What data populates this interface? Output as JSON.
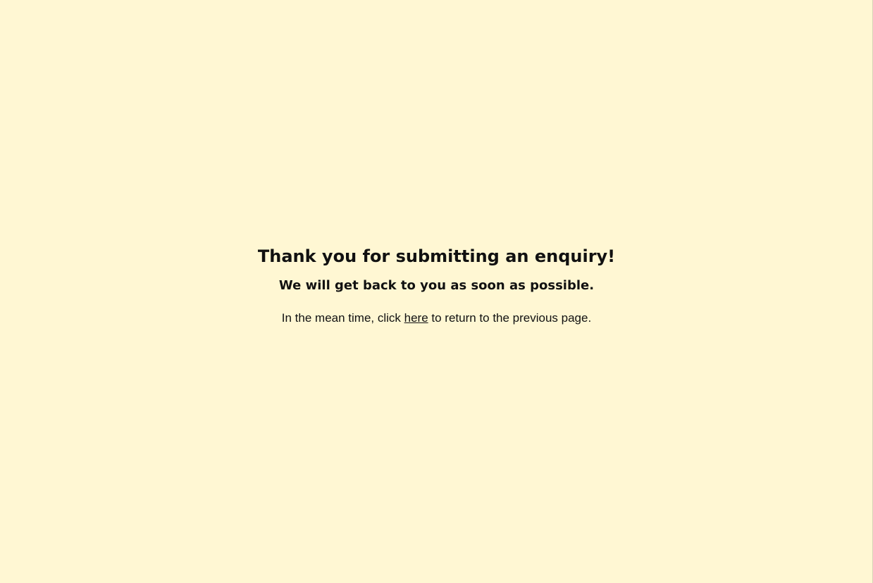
{
  "colors": {
    "background": "#fff7d3",
    "text": "#111111"
  },
  "confirmation": {
    "title": "Thank you for submitting an enquiry!",
    "subtitle": "We will get back to you as soon as possible.",
    "message_before": "In the mean time, click ",
    "link_text": "here",
    "message_after": " to return to the previous page."
  }
}
